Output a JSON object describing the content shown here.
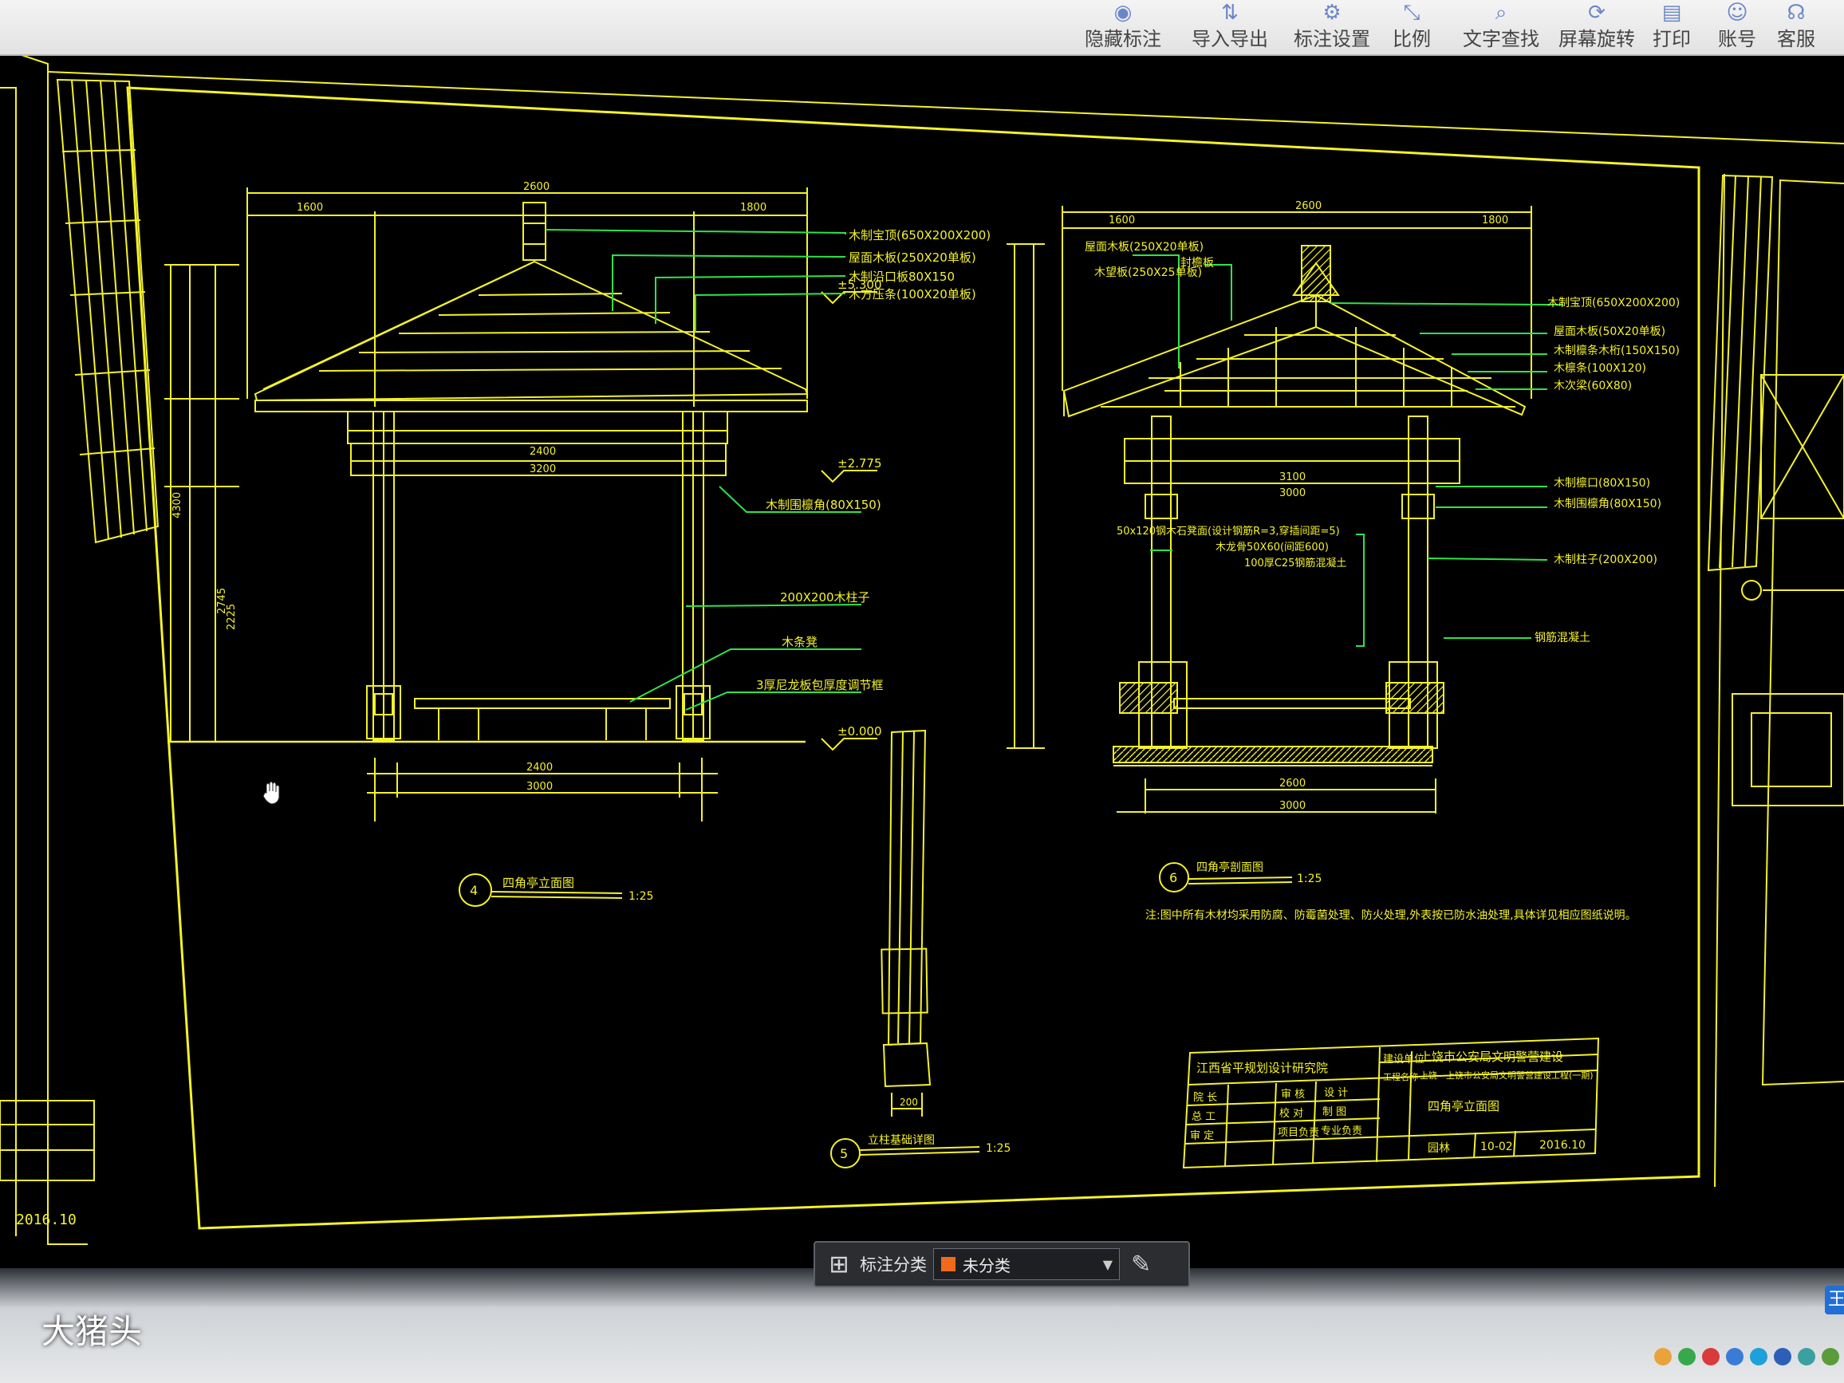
{
  "toolbar": {
    "items": [
      {
        "label": "隐藏标注",
        "icon": "eye-off-icon"
      },
      {
        "label": "导入导出",
        "icon": "import-export-icon"
      },
      {
        "label": "标注设置",
        "icon": "settings-icon"
      },
      {
        "label": "比例",
        "icon": "scale-icon"
      },
      {
        "label": "文字查找",
        "icon": "text-search-icon"
      },
      {
        "label": "屏幕旋转",
        "icon": "rotate-screen-icon"
      },
      {
        "label": "打印",
        "icon": "print-icon"
      },
      {
        "label": "账号",
        "icon": "account-icon"
      },
      {
        "label": "客服",
        "icon": "headset-icon"
      }
    ]
  },
  "drawing": {
    "left_view": {
      "title": "四角亭立面图",
      "number": "4",
      "scale": "1:25",
      "dims_top": [
        "1600",
        "2600",
        "1800"
      ],
      "callouts": [
        "木制宝顶(650X200X200)",
        "屋面木板(250X20单板)",
        "木制沿口板80X150",
        "木方压条(100X20单板)",
        "木制围檩角(80X150)",
        "200X200木柱子",
        "木条凳",
        "3厚尼龙板包厚度调节框"
      ],
      "levels": [
        "±5.300",
        "±2.775",
        "±0.000"
      ],
      "dims_bottom": [
        "2400",
        "3000"
      ],
      "dims_side": [
        "2745",
        "2225",
        "4300"
      ],
      "span_labels": [
        "2400",
        "3200"
      ]
    },
    "right_view": {
      "title": "四角亭剖面图",
      "number": "6",
      "scale": "1:25",
      "dims_top": [
        "1600",
        "2600",
        "1800"
      ],
      "callouts_left": [
        "屋面木板(250X20单板)",
        "木望板(250X25单板)",
        "封檐板"
      ],
      "callouts_right": [
        "木制宝顶(650X200X200)",
        "屋面木板(50X20单板)",
        "木制檩条木桁(150X150)",
        "木檩条(100X120)",
        "木次梁(60X80)",
        "木制檩口(80X150)",
        "木制围檩角(80X150)",
        "木制柱子(200X200)",
        "钢筋混凝土"
      ],
      "notes_mid": [
        "50x120钢木石凳面(设计钢筋R=3,穿插间距=5)",
        "木龙骨50X60(间距600)",
        "100厚C25钢筋混凝土"
      ],
      "dims_bottom": [
        "2600",
        "3000"
      ],
      "span_labels": [
        "3100",
        "3000"
      ],
      "note": "注:图中所有木材均采用防腐、防霉菌处理、防火处理,外表按已防水油处理,具体详见相应图纸说明。"
    },
    "column_view": {
      "title": "立柱基础详图",
      "number": "5",
      "scale": "1:25",
      "dim": "200"
    },
    "title_block": {
      "company": "江西省平规划设计研究院",
      "project_label": "建设单位",
      "project": "上饶市公安局文明警营建设",
      "engineering_label": "工程名称",
      "engineering": "上饶—上饶市公安局文明警营建设工程(一期)",
      "drawing_name": "四角亭立面图",
      "rows": [
        [
          "院 长",
          "审 核",
          "设 计"
        ],
        [
          "总 工",
          "校 对",
          "制 图"
        ],
        [
          "审 定",
          "项目负责",
          "专业负责"
        ]
      ],
      "sheet": "10-02",
      "date": "2016.10",
      "category": "园林"
    },
    "left_sheet_date": "2016.10"
  },
  "annotation_bar": {
    "label": "标注分类",
    "selected": "未分类",
    "swatch_color": "#f06a1c"
  },
  "watermark": "大猪头",
  "colors": {
    "cad_yellow": "#f4f22a",
    "cad_green": "#2fe24a",
    "background": "#000000"
  }
}
